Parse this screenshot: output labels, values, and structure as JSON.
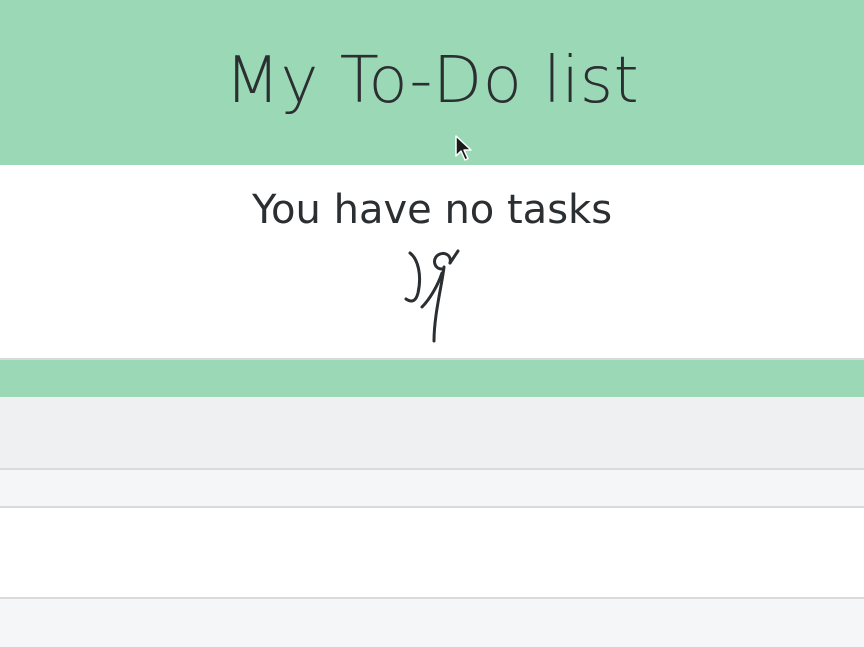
{
  "header": {
    "title": "My To-Do list"
  },
  "empty_state": {
    "message": "You have no tasks",
    "illustration": "dancing-figure-icon"
  },
  "cursor": {
    "icon": "mouse-pointer-icon"
  },
  "colors": {
    "accent_green": "#9bd8b5",
    "text_dark": "#2b2f32",
    "panel_gray": "#eff0f1",
    "row_light": "#f5f6f8",
    "divider": "#d8dbdd"
  }
}
